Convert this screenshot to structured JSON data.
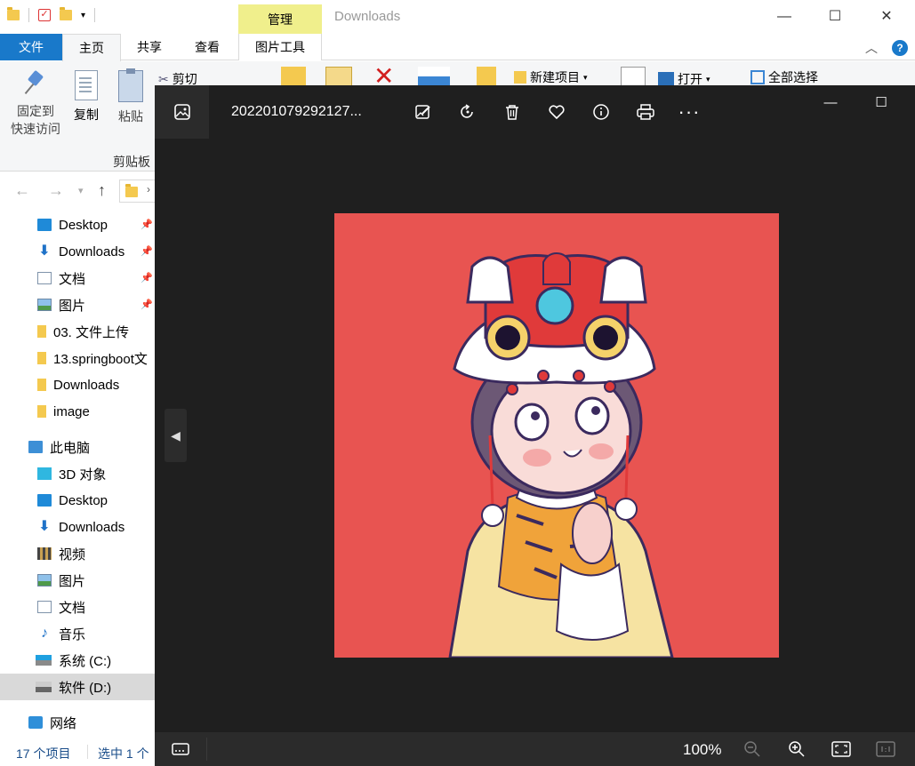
{
  "explorer": {
    "window_title": "Downloads",
    "contextual_tab_group": "管理",
    "tabs": {
      "file": "文件",
      "home": "主页",
      "share": "共享",
      "view": "查看",
      "picture_tools": "图片工具"
    },
    "ribbon": {
      "pin_quick_access_line1": "固定到",
      "pin_quick_access_line2": "快速访问",
      "copy": "复制",
      "paste": "粘贴",
      "cut": "剪切",
      "clipboard_group": "剪贴板",
      "new_item": "新建项目",
      "open": "打开",
      "select_all": "全部选择"
    },
    "nav": {
      "quick_access": [
        {
          "label": "Desktop",
          "pinned": true
        },
        {
          "label": "Downloads",
          "pinned": true
        },
        {
          "label": "文档",
          "pinned": true
        },
        {
          "label": "图片",
          "pinned": true
        },
        {
          "label": "03. 文件上传"
        },
        {
          "label": "13.springboot文"
        },
        {
          "label": "Downloads"
        },
        {
          "label": "image"
        }
      ],
      "this_pc": "此电脑",
      "pc_items": [
        {
          "label": "3D 对象"
        },
        {
          "label": "Desktop"
        },
        {
          "label": "Downloads"
        },
        {
          "label": "视频"
        },
        {
          "label": "图片"
        },
        {
          "label": "文档"
        },
        {
          "label": "音乐"
        },
        {
          "label": "系统 (C:)"
        },
        {
          "label": "软件 (D:)",
          "selected": true
        }
      ],
      "network": "网络"
    },
    "status": {
      "item_count": "17 个项目",
      "selected": "选中 1 个"
    }
  },
  "viewer": {
    "filename": "202201079292127...",
    "toolbar_icons": [
      "edit-icon",
      "rotate-icon",
      "delete-icon",
      "favorite-icon",
      "info-icon",
      "print-icon",
      "more-icon"
    ],
    "more_label": "···",
    "zoom": "100%",
    "image_background": "#e85451"
  }
}
